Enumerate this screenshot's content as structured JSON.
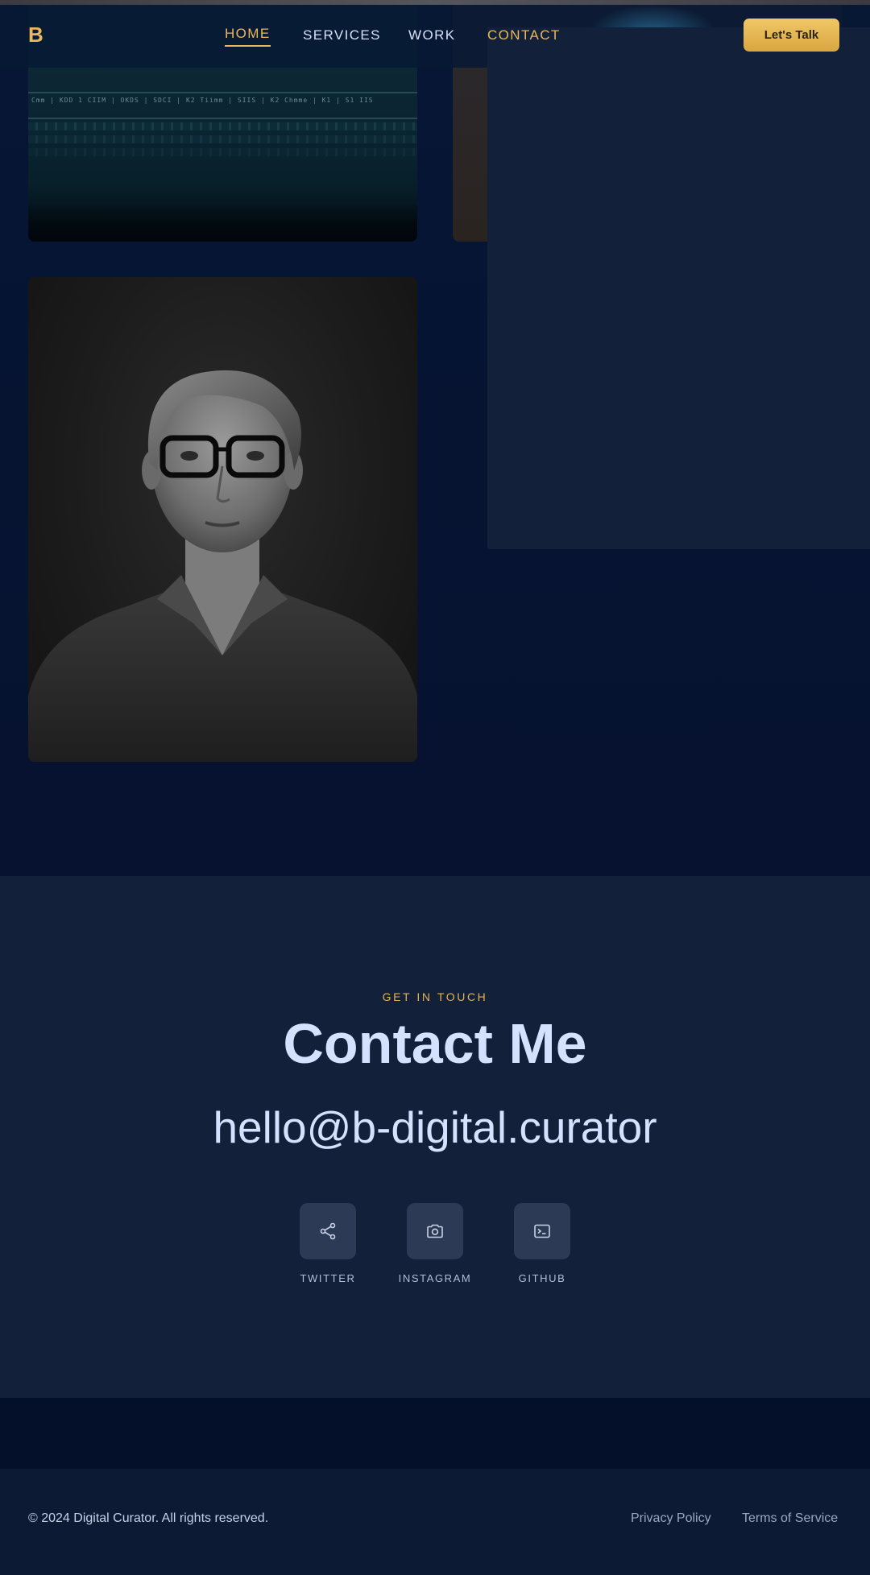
{
  "header": {
    "logo": "B",
    "nav": [
      "HOME",
      "SERVICES",
      "WORK",
      "CONTACT"
    ],
    "active_nav": "HOME",
    "cta_label": "Let's Talk"
  },
  "work": {
    "code_snippet": "Cmm | KDD 1 CIIM | OKDS | SDCI | K2 Tiimm | SIIS | K2 Chmme | K1 | S1 IIS"
  },
  "contact": {
    "eyebrow": "GET IN TOUCH",
    "title": "Contact Me",
    "email": "hello@b-digital.curator",
    "socials": [
      {
        "label": "TWITTER",
        "icon": "share-icon"
      },
      {
        "label": "INSTAGRAM",
        "icon": "camera-icon"
      },
      {
        "label": "GITHUB",
        "icon": "terminal-icon"
      }
    ]
  },
  "footer": {
    "copyright": "© 2024 Digital Curator. All rights reserved.",
    "links": [
      "Privacy Policy",
      "Terms of Service"
    ]
  },
  "colors": {
    "accent": "#e9b85a",
    "background": "#061331",
    "section": "#13203a",
    "text": "#d4e1ff"
  }
}
